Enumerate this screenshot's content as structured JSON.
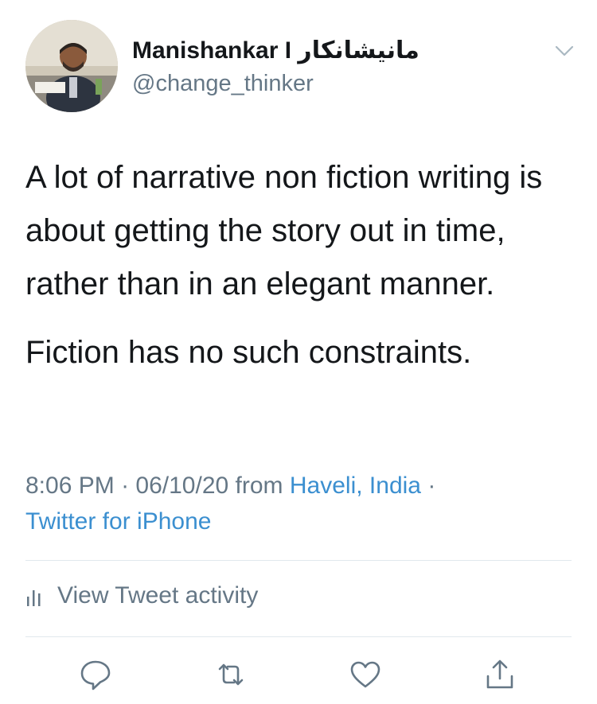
{
  "user": {
    "display_name": "Manishankar I",
    "display_name_urdu": "مانیشانکار",
    "handle": "@change_thinker"
  },
  "tweet": {
    "paragraphs": [
      "A lot of narrative non fiction writing is about getting the story out in time, rather than in an elegant manner.",
      "Fiction has no such constraints."
    ]
  },
  "meta": {
    "time": "8:06 PM",
    "separator": "·",
    "date": "06/10/20",
    "from_label": "from",
    "location": "Haveli, India",
    "client": "Twitter for iPhone"
  },
  "activity": {
    "label": "View Tweet activity"
  },
  "actions": [
    {
      "name": "reply-icon"
    },
    {
      "name": "retweet-icon"
    },
    {
      "name": "like-icon"
    },
    {
      "name": "share-icon"
    }
  ],
  "colors": {
    "text": "#14171a",
    "secondary": "#657786",
    "link": "#3b8fd0",
    "divider": "#e1e8ed"
  }
}
